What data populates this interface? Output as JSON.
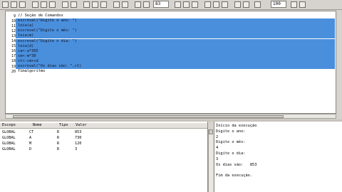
{
  "toolbar": {
    "zoom_combo": "83",
    "font_combo": "100"
  },
  "editor": {
    "lines": [
      {
        "num": "9",
        "text": "// Seção de Comandos",
        "selected": false
      },
      {
        "num": "10",
        "text": "escreval(\"Digite o ano: \")",
        "selected": true
      },
      {
        "num": "11",
        "text": "leia(a)",
        "selected": true
      },
      {
        "num": "12",
        "text": "escreval(\"Digite o mês: \")",
        "selected": true
      },
      {
        "num": "13",
        "text": "leia(m)",
        "selected": true
      },
      {
        "num": "14",
        "text": "escreval(\"Digite o dia: \")",
        "selected": true
      },
      {
        "num": "15",
        "text": "leia(d)",
        "selected": true
      },
      {
        "num": "16",
        "text": "ca<-a*365",
        "selected": true
      },
      {
        "num": "17",
        "text": "cm<-m*30",
        "selected": true
      },
      {
        "num": "18",
        "text": "ct<-cm+cd",
        "selected": true
      },
      {
        "num": "19",
        "text": "escreval(\"Os dias são: \",ct)",
        "selected": true
      },
      {
        "num": "20",
        "text": "fimalgoritmo",
        "selected": false
      }
    ]
  },
  "variables": {
    "headers": [
      "Escopo",
      "Nome",
      "Tipo",
      "Valor"
    ],
    "rows": [
      [
        "GLOBAL",
        "CT",
        "R",
        "853"
      ],
      [
        "GLOBAL",
        "A",
        "R",
        "730"
      ],
      [
        "GLOBAL",
        "M",
        "R",
        "120"
      ],
      [
        "GLOBAL",
        "D",
        "R",
        "3"
      ]
    ]
  },
  "console": {
    "lines": [
      "Início da execução",
      "Digite o ano:",
      "2",
      "Digite o mês:",
      "4",
      "Digite o dia:",
      "3",
      "Os dias são:   853",
      "",
      "Fim da execução."
    ]
  }
}
